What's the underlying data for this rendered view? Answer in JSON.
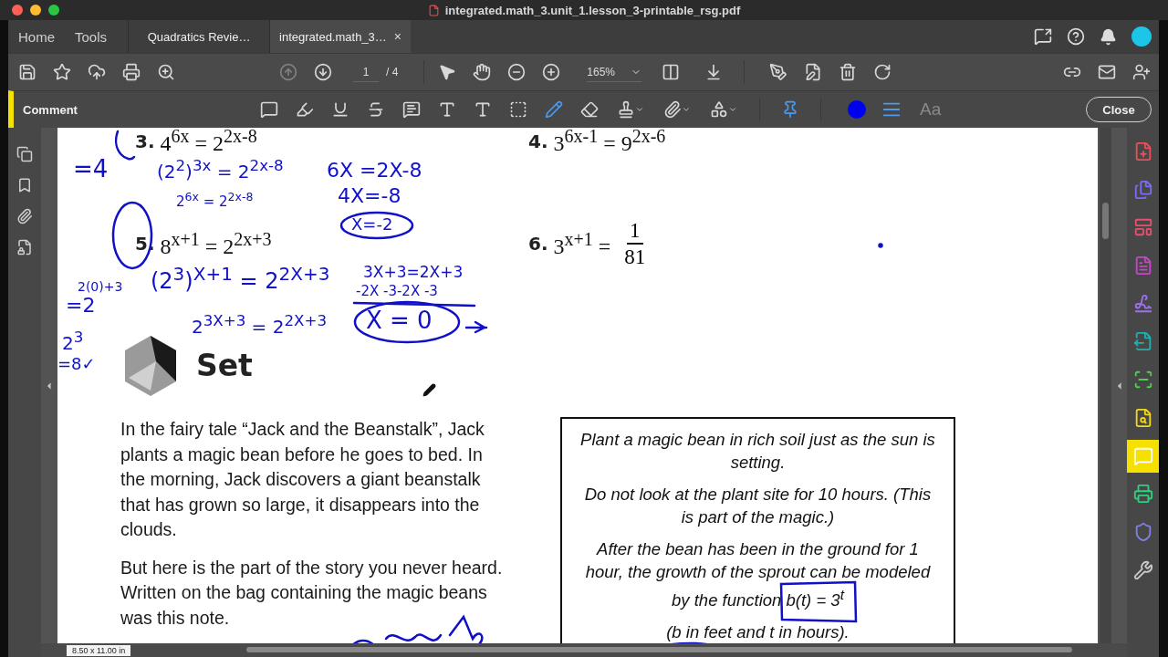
{
  "window": {
    "title": "integrated.math_3.unit_1.lesson_3-printable_rsg.pdf"
  },
  "nav": [
    {
      "label": "Home"
    },
    {
      "label": "Tools"
    }
  ],
  "doc_tabs": [
    {
      "label": "Quadratics Revie…",
      "selected": false
    },
    {
      "label": "integrated.math_3…",
      "selected": true,
      "close": "×"
    }
  ],
  "toolbar": {
    "prev_page_disabled": true,
    "page": "1",
    "page_total": "/ 4",
    "zoom": "165%"
  },
  "comment_bar": {
    "title": "Comment",
    "tools": [
      {
        "kind": "note",
        "selected": false
      },
      {
        "kind": "highlight",
        "selected": false
      },
      {
        "kind": "underline",
        "selected": false
      },
      {
        "kind": "strike",
        "selected": false
      },
      {
        "kind": "replace",
        "selected": false
      },
      {
        "kind": "insert",
        "selected": false
      },
      {
        "kind": "text",
        "selected": false
      },
      {
        "kind": "textbox",
        "selected": false
      },
      {
        "kind": "pencil",
        "selected": true
      },
      {
        "kind": "eraser",
        "selected": false
      },
      {
        "kind": "stamp",
        "selected": false
      },
      {
        "kind": "attach",
        "selected": false
      },
      {
        "kind": "shapes",
        "selected": false
      },
      {
        "kind": "pin",
        "selected": true
      }
    ],
    "font_button": "Aa",
    "close": "Close"
  },
  "right_tools": [
    {
      "kind": "create",
      "color": "#e8505b",
      "selected": false
    },
    {
      "kind": "combine",
      "color": "#7b6cf6",
      "selected": false
    },
    {
      "kind": "organize",
      "color": "#e8506e",
      "selected": false
    },
    {
      "kind": "edit",
      "color": "#c845c8",
      "selected": false
    },
    {
      "kind": "sign",
      "color": "#a070f0",
      "selected": false
    },
    {
      "kind": "export",
      "color": "#20b0b0",
      "selected": false
    },
    {
      "kind": "scan",
      "color": "#50d050",
      "selected": false
    },
    {
      "kind": "review",
      "color": "#f0d820",
      "selected": false
    },
    {
      "kind": "comment",
      "color": "#f5e000",
      "selected": true
    },
    {
      "kind": "print",
      "color": "#30d080",
      "selected": false
    },
    {
      "kind": "protect",
      "color": "#8080e0",
      "selected": false
    },
    {
      "kind": "more",
      "color": "#cccccc",
      "selected": false
    }
  ],
  "document": {
    "problems": [
      {
        "number": "3.",
        "equation": "4$^{6x}$ = 2$^{2x-8}$"
      },
      {
        "number": "4.",
        "equation": "3$^{6x-1}$ = 9$^{2x-6}$"
      },
      {
        "number": "5.",
        "equation": "8$^{x+1}$ = 2$^{2x+3}$"
      },
      {
        "number": "6.",
        "equation": "3$^{x+1}$ =",
        "fraction": {
          "numerator": "1",
          "denominator": "81"
        }
      }
    ],
    "section": "Set",
    "paragraphs": [
      "In the fairy tale “Jack and the Beanstalk”, Jack plants a magic bean before he goes to bed. In the morning, Jack discovers a giant beanstalk that has grown so large, it disappears into the clouds.",
      "But here is the part of the story you never heard. Written on the bag containing the magic beans was this note."
    ],
    "note": [
      "Plant a magic bean in rich soil just as the sun is setting.",
      "Do not look at the plant site for 10 hours. (This is part of the magic.)",
      "After the bean has been in the ground for 1 hour, the growth of the sprout can be modeled by the function b(t) = 3$^{t}$",
      "(b in feet and t in hours)."
    ]
  },
  "ink_notes": [
    "=4",
    "(2$^{2}$)$^{3x}$ = 2$^{2x-8}$",
    "2$^{6x}$ = 2$^{2x-8}$",
    "6X =2X-8",
    "4X=-8",
    "X=-2",
    "2(0)+3",
    "(2$^{3}$)$^{X+1}$ = 2$^{2X+3}$",
    "=2",
    "2$^{3X+3}$ = 2$^{2X+3}$",
    "3X+3=2X+3",
    "-2X -3-2X -3",
    "X = 0",
    "2$^{3}$",
    "=8✓"
  ],
  "status": {
    "page_size": "8.50 x 11.00 in"
  }
}
